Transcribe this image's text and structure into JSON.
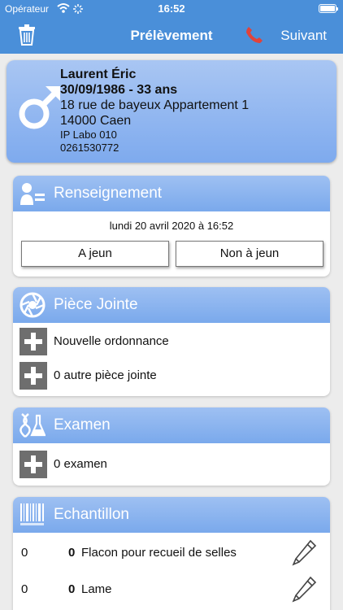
{
  "status": {
    "carrier": "Opérateur",
    "time": "16:52"
  },
  "nav": {
    "title": "Prélèvement",
    "next_label": "Suivant"
  },
  "patient": {
    "name": "Laurent Éric",
    "dob_age": "30/09/1986 - 33 ans",
    "address1": "18 rue de bayeux Appartement 1",
    "address2": "14000 Caen",
    "ip": "IP Labo 010",
    "phone": "0261530772"
  },
  "renseignement": {
    "title": "Renseignement",
    "date": "lundi 20 avril 2020 à 16:52",
    "button_a": "A jeun",
    "button_b": "Non à jeun"
  },
  "piece": {
    "title": "Pièce Jointe",
    "item1": "Nouvelle ordonnance",
    "item2": "0 autre pièce jointe"
  },
  "examen": {
    "title": "Examen",
    "item1": "0 examen"
  },
  "echantillon": {
    "title": "Echantillon",
    "rows": [
      {
        "count": "0",
        "qty": "0",
        "label": "Flacon pour recueil de selles"
      },
      {
        "count": "0",
        "qty": "0",
        "label": "Lame"
      }
    ]
  },
  "colors": {
    "accent": "#4a8fd9",
    "header": "#8db6ef",
    "phone_icon": "#e0433b"
  }
}
